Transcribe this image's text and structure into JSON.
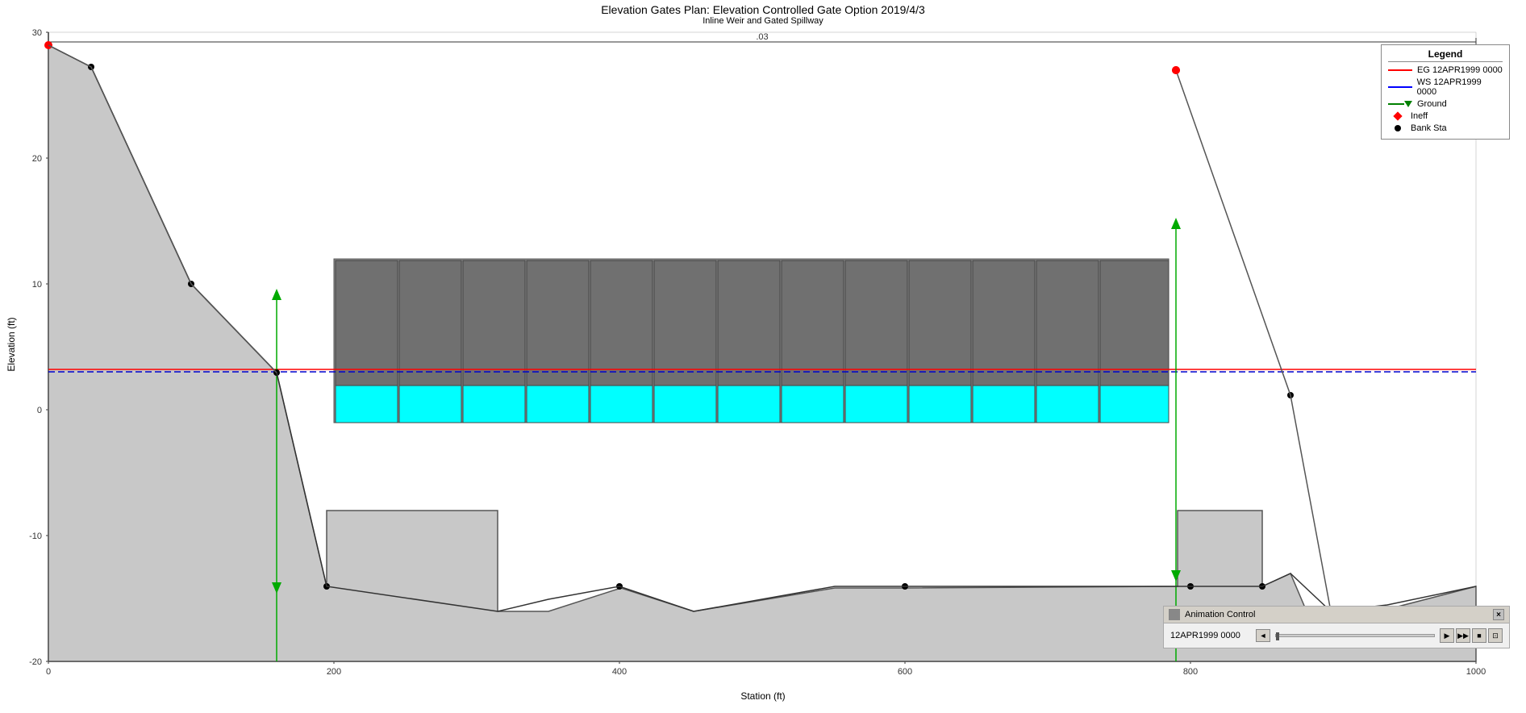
{
  "title": {
    "main": "Elevation Gates    Plan: Elevation Controlled Gate Option    2019/4/3",
    "sub": "Inline Weir and Gated Spillway"
  },
  "axes": {
    "x_label": "Station (ft)",
    "y_label": "Elevation (ft)",
    "x_ticks": [
      "0",
      "200",
      "400",
      "600",
      "800",
      "1000"
    ],
    "y_ticks": [
      "30",
      "20",
      "10",
      "0",
      "-10",
      "-20"
    ],
    "x_scale_label": ".03"
  },
  "legend": {
    "title": "Legend",
    "items": [
      {
        "label": "EG 12APR1999 0000",
        "type": "line-red"
      },
      {
        "label": "WS 12APR1999 0000",
        "type": "line-blue"
      },
      {
        "label": "Ground",
        "type": "line-green-triangle"
      },
      {
        "label": "Ineff",
        "type": "diamond-red"
      },
      {
        "label": "Bank Sta",
        "type": "dot-black"
      }
    ]
  },
  "animation_control": {
    "title": "Animation Control",
    "close_label": "×",
    "time_label": "12APR1999 0000",
    "buttons": [
      "◄",
      "◀",
      "▶",
      "■",
      "⊡"
    ]
  }
}
